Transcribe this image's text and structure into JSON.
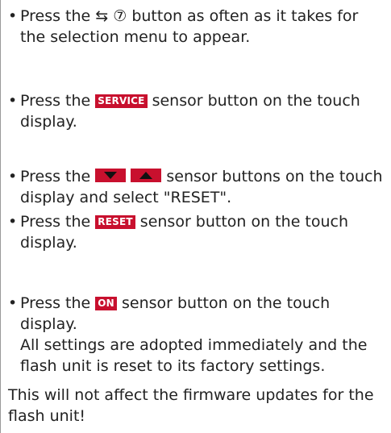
{
  "steps": [
    {
      "bullet": "•",
      "before": "Press the",
      "symbol": "⇆ ⑦",
      "after": "button as often as it takes for the selection menu to appear."
    },
    {
      "bullet": "•",
      "before": "Press the",
      "badge": "SERVICE",
      "after": "sensor button on the touch display."
    },
    {
      "bullet": "•",
      "before": "Press the",
      "icons": [
        "arrow-down-icon",
        "arrow-up-icon"
      ],
      "after": "sensor buttons on the touch display and select \"RESET\"."
    },
    {
      "bullet": "•",
      "before": "Press the",
      "badge": "RESET",
      "after": "sensor button on the touch display."
    },
    {
      "bullet": "•",
      "before": "Press the",
      "badge": "ON",
      "after": "sensor button on the touch display.",
      "result": "All settings are adopted immediately and the flash unit is reset to its factory settings."
    }
  ],
  "note": "This will not affect the firmware updates for the flash unit!",
  "colors": {
    "badge": "#c8102e",
    "text": "#222222"
  }
}
